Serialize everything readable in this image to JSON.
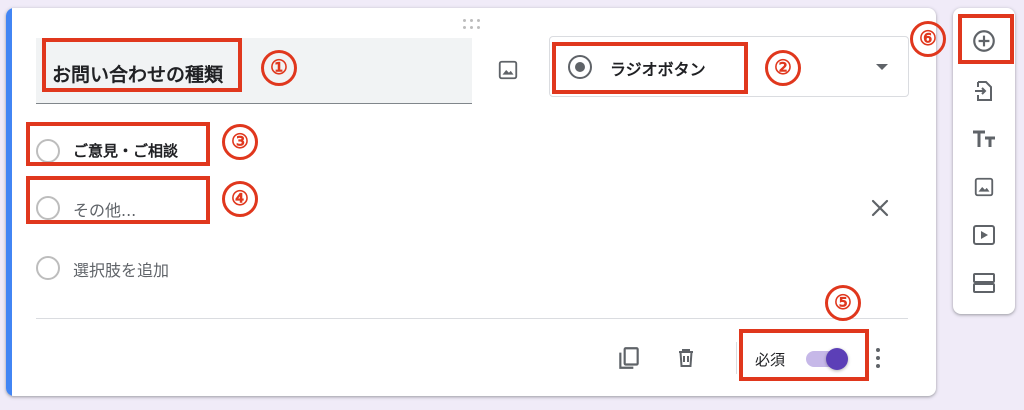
{
  "question": {
    "title": "お問い合わせの種類",
    "type_label": "ラジオボタン",
    "options": [
      {
        "label": "ご意見・ご相談"
      },
      {
        "label": "その他..."
      }
    ],
    "add_option_label": "選択肢を追加"
  },
  "footer": {
    "required_label": "必須",
    "required_on": true
  },
  "side_toolbar": {
    "icons": [
      "add-circle-icon",
      "import-question-icon",
      "title-text-icon",
      "image-icon",
      "video-icon",
      "section-icon"
    ]
  },
  "annotations": {
    "markers": [
      "①",
      "②",
      "③",
      "④",
      "⑤",
      "⑥"
    ]
  },
  "colors": {
    "accent": "#4285f4",
    "toggle_on": "#5c3fb7",
    "highlight": "#e0371d",
    "background": "#f0ebf8"
  }
}
